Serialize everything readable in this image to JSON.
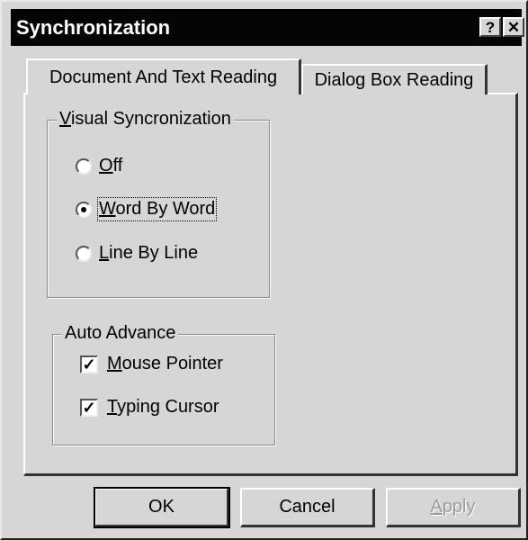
{
  "window": {
    "title": "Synchronization",
    "help_label": "?",
    "close_label": "✕"
  },
  "tabs": [
    {
      "label": "Document And Text Reading",
      "active": true
    },
    {
      "label": "Dialog Box Reading",
      "active": false
    }
  ],
  "visual_sync": {
    "legend_prefix": "V",
    "legend_rest": "isual Syncronization",
    "options": [
      {
        "underline": "O",
        "rest": "ff",
        "selected": false
      },
      {
        "underline": "W",
        "rest": "ord By Word",
        "selected": true
      },
      {
        "underline": "L",
        "rest": "ine By Line",
        "selected": false
      }
    ]
  },
  "auto_advance": {
    "legend": "Auto Advance",
    "options": [
      {
        "underline": "M",
        "rest": "ouse Pointer",
        "checked": true
      },
      {
        "underline": "T",
        "rest": "yping Cursor",
        "checked": true
      }
    ],
    "check_mark": "✓"
  },
  "buttons": {
    "ok": "OK",
    "cancel": "Cancel",
    "apply_underline": "A",
    "apply_rest": "pply"
  }
}
